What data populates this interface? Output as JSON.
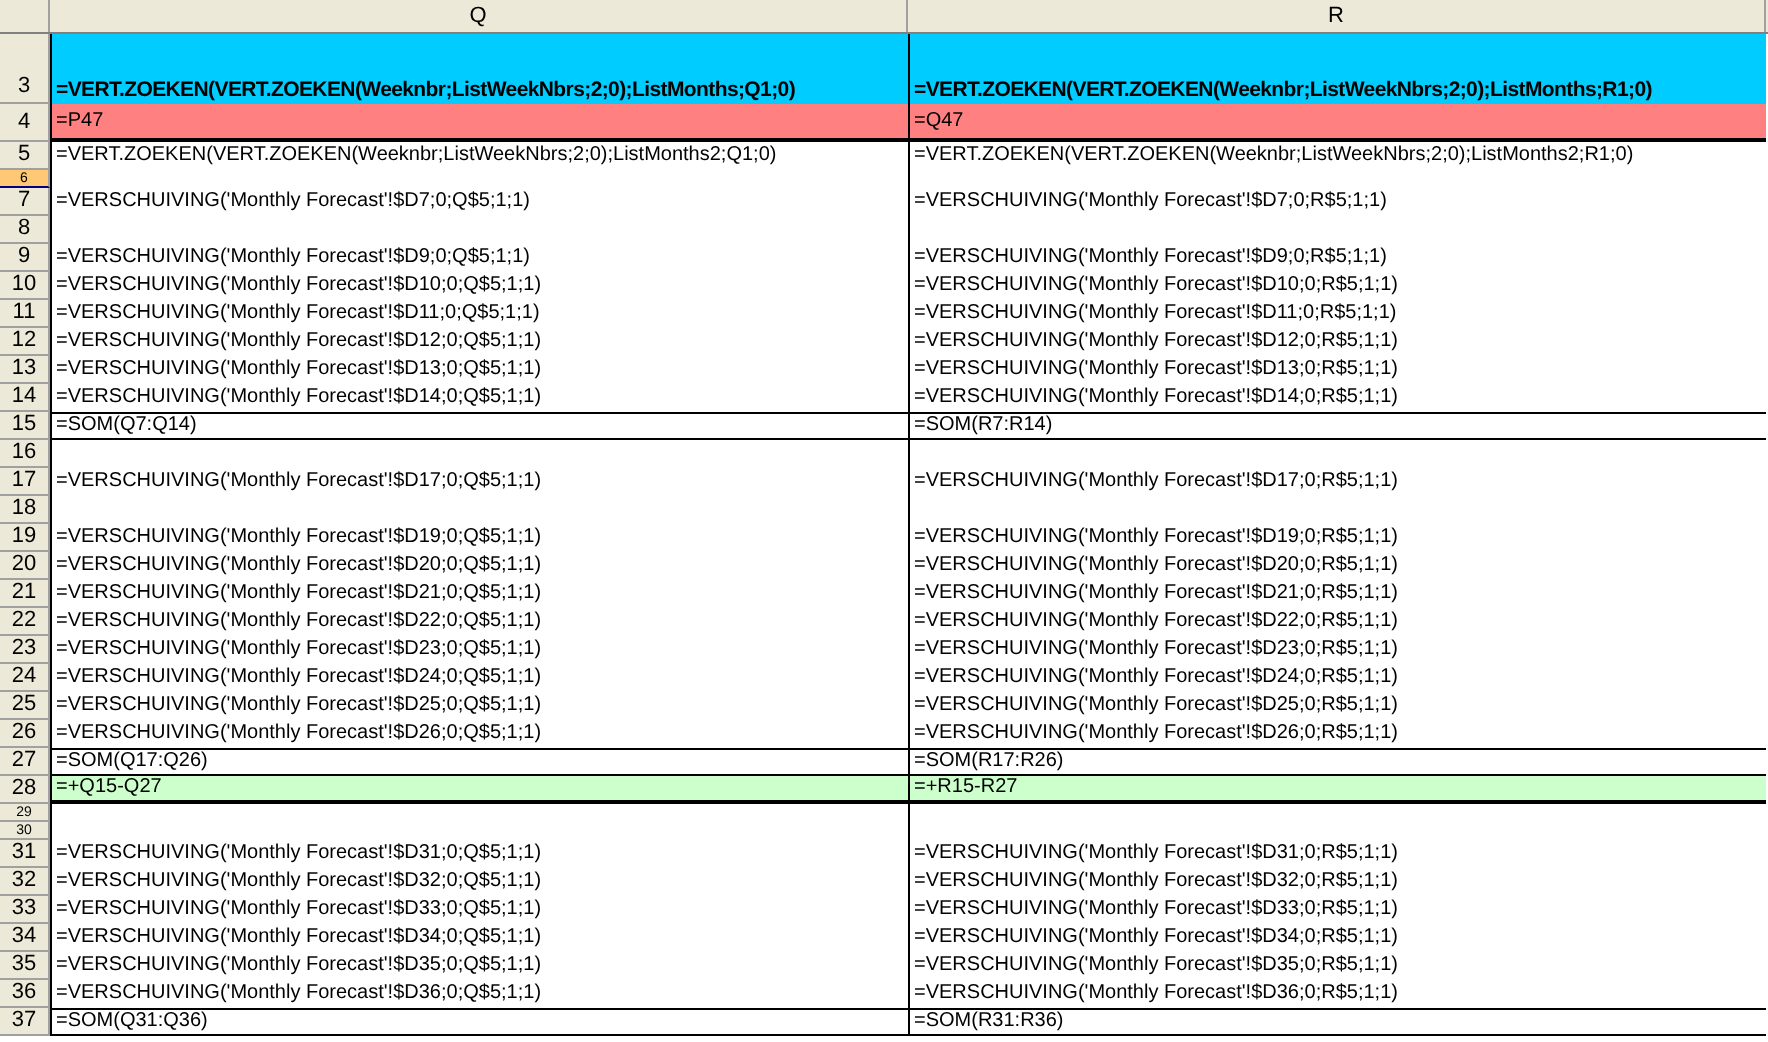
{
  "columns": [
    {
      "label": "Q"
    },
    {
      "label": "R"
    }
  ],
  "rows": [
    {
      "number": "3",
      "kind": "title",
      "selected": false,
      "cells": [
        "=VERT.ZOEKEN(VERT.ZOEKEN(Weeknbr;ListWeekNbrs;2;0);ListMonths;Q1;0)",
        "=VERT.ZOEKEN(VERT.ZOEKEN(Weeknbr;ListWeekNbrs;2;0);ListMonths;R1;0)"
      ]
    },
    {
      "number": "4",
      "kind": "pink",
      "selected": false,
      "cells": [
        "=P47",
        "=Q47"
      ]
    },
    {
      "number": "5",
      "kind": "plain",
      "selected": false,
      "cells": [
        "=VERT.ZOEKEN(VERT.ZOEKEN(Weeknbr;ListWeekNbrs;2;0);ListMonths2;Q1;0)",
        "=VERT.ZOEKEN(VERT.ZOEKEN(Weeknbr;ListWeekNbrs;2;0);ListMonths2;R1;0)"
      ]
    },
    {
      "number": "6",
      "kind": "short",
      "selected": true
    },
    {
      "number": "7",
      "kind": "plain",
      "selected": false,
      "cells": [
        "=VERSCHUIVING('Monthly Forecast'!$D7;0;Q$5;1;1)",
        "=VERSCHUIVING('Monthly Forecast'!$D7;0;R$5;1;1)"
      ]
    },
    {
      "number": "8",
      "kind": "plain",
      "selected": false
    },
    {
      "number": "9",
      "kind": "plain",
      "selected": false,
      "cells": [
        "=VERSCHUIVING('Monthly Forecast'!$D9;0;Q$5;1;1)",
        "=VERSCHUIVING('Monthly Forecast'!$D9;0;R$5;1;1)"
      ]
    },
    {
      "number": "10",
      "kind": "plain",
      "selected": false,
      "cells": [
        "=VERSCHUIVING('Monthly Forecast'!$D10;0;Q$5;1;1)",
        "=VERSCHUIVING('Monthly Forecast'!$D10;0;R$5;1;1)"
      ]
    },
    {
      "number": "11",
      "kind": "plain",
      "selected": false,
      "cells": [
        "=VERSCHUIVING('Monthly Forecast'!$D11;0;Q$5;1;1)",
        "=VERSCHUIVING('Monthly Forecast'!$D11;0;R$5;1;1)"
      ]
    },
    {
      "number": "12",
      "kind": "plain",
      "selected": false,
      "cells": [
        "=VERSCHUIVING('Monthly Forecast'!$D12;0;Q$5;1;1)",
        "=VERSCHUIVING('Monthly Forecast'!$D12;0;R$5;1;1)"
      ]
    },
    {
      "number": "13",
      "kind": "plain",
      "selected": false,
      "cells": [
        "=VERSCHUIVING('Monthly Forecast'!$D13;0;Q$5;1;1)",
        "=VERSCHUIVING('Monthly Forecast'!$D13;0;R$5;1;1)"
      ]
    },
    {
      "number": "14",
      "kind": "plain",
      "selected": false,
      "cells": [
        "=VERSCHUIVING('Monthly Forecast'!$D14;0;Q$5;1;1)",
        "=VERSCHUIVING('Monthly Forecast'!$D14;0;R$5;1;1)"
      ]
    },
    {
      "number": "15",
      "kind": "total",
      "selected": false,
      "cells": [
        "=SOM(Q7:Q14)",
        "=SOM(R7:R14)"
      ]
    },
    {
      "number": "16",
      "kind": "plain",
      "selected": false
    },
    {
      "number": "17",
      "kind": "plain",
      "selected": false,
      "cells": [
        "=VERSCHUIVING('Monthly Forecast'!$D17;0;Q$5;1;1)",
        "=VERSCHUIVING('Monthly Forecast'!$D17;0;R$5;1;1)"
      ]
    },
    {
      "number": "18",
      "kind": "plain",
      "selected": false
    },
    {
      "number": "19",
      "kind": "plain",
      "selected": false,
      "cells": [
        "=VERSCHUIVING('Monthly Forecast'!$D19;0;Q$5;1;1)",
        "=VERSCHUIVING('Monthly Forecast'!$D19;0;R$5;1;1)"
      ]
    },
    {
      "number": "20",
      "kind": "plain",
      "selected": false,
      "cells": [
        "=VERSCHUIVING('Monthly Forecast'!$D20;0;Q$5;1;1)",
        "=VERSCHUIVING('Monthly Forecast'!$D20;0;R$5;1;1)"
      ]
    },
    {
      "number": "21",
      "kind": "plain",
      "selected": false,
      "cells": [
        "=VERSCHUIVING('Monthly Forecast'!$D21;0;Q$5;1;1)",
        "=VERSCHUIVING('Monthly Forecast'!$D21;0;R$5;1;1)"
      ]
    },
    {
      "number": "22",
      "kind": "plain",
      "selected": false,
      "cells": [
        "=VERSCHUIVING('Monthly Forecast'!$D22;0;Q$5;1;1)",
        "=VERSCHUIVING('Monthly Forecast'!$D22;0;R$5;1;1)"
      ]
    },
    {
      "number": "23",
      "kind": "plain",
      "selected": false,
      "cells": [
        "=VERSCHUIVING('Monthly Forecast'!$D23;0;Q$5;1;1)",
        "=VERSCHUIVING('Monthly Forecast'!$D23;0;R$5;1;1)"
      ]
    },
    {
      "number": "24",
      "kind": "plain",
      "selected": false,
      "cells": [
        "=VERSCHUIVING('Monthly Forecast'!$D24;0;Q$5;1;1)",
        "=VERSCHUIVING('Monthly Forecast'!$D24;0;R$5;1;1)"
      ]
    },
    {
      "number": "25",
      "kind": "plain",
      "selected": false,
      "cells": [
        "=VERSCHUIVING('Monthly Forecast'!$D25;0;Q$5;1;1)",
        "=VERSCHUIVING('Monthly Forecast'!$D25;0;R$5;1;1)"
      ]
    },
    {
      "number": "26",
      "kind": "plain",
      "selected": false,
      "cells": [
        "=VERSCHUIVING('Monthly Forecast'!$D26;0;Q$5;1;1)",
        "=VERSCHUIVING('Monthly Forecast'!$D26;0;R$5;1;1)"
      ]
    },
    {
      "number": "27",
      "kind": "total",
      "selected": false,
      "cells": [
        "=SOM(Q17:Q26)",
        "=SOM(R17:R26)"
      ]
    },
    {
      "number": "28",
      "kind": "green",
      "selected": false,
      "cells": [
        "=+Q15-Q27",
        "=+R15-R27"
      ]
    },
    {
      "number": "29",
      "kind": "short",
      "selected": false
    },
    {
      "number": "30",
      "kind": "short",
      "selected": false
    },
    {
      "number": "31",
      "kind": "plain",
      "selected": false,
      "cells": [
        "=VERSCHUIVING('Monthly Forecast'!$D31;0;Q$5;1;1)",
        "=VERSCHUIVING('Monthly Forecast'!$D31;0;R$5;1;1)"
      ]
    },
    {
      "number": "32",
      "kind": "plain",
      "selected": false,
      "cells": [
        "=VERSCHUIVING('Monthly Forecast'!$D32;0;Q$5;1;1)",
        "=VERSCHUIVING('Monthly Forecast'!$D32;0;R$5;1;1)"
      ]
    },
    {
      "number": "33",
      "kind": "plain",
      "selected": false,
      "cells": [
        "=VERSCHUIVING('Monthly Forecast'!$D33;0;Q$5;1;1)",
        "=VERSCHUIVING('Monthly Forecast'!$D33;0;R$5;1;1)"
      ]
    },
    {
      "number": "34",
      "kind": "plain",
      "selected": false,
      "cells": [
        "=VERSCHUIVING('Monthly Forecast'!$D34;0;Q$5;1;1)",
        "=VERSCHUIVING('Monthly Forecast'!$D34;0;R$5;1;1)"
      ]
    },
    {
      "number": "35",
      "kind": "plain",
      "selected": false,
      "cells": [
        "=VERSCHUIVING('Monthly Forecast'!$D35;0;Q$5;1;1)",
        "=VERSCHUIVING('Monthly Forecast'!$D35;0;R$5;1;1)"
      ]
    },
    {
      "number": "36",
      "kind": "plain",
      "selected": false,
      "cells": [
        "=VERSCHUIVING('Monthly Forecast'!$D36;0;Q$5;1;1)",
        "=VERSCHUIVING('Monthly Forecast'!$D36;0;R$5;1;1)"
      ]
    },
    {
      "number": "37",
      "kind": "total",
      "selected": false,
      "cells": [
        "=SOM(Q31:Q36)",
        "=SOM(R31:R36)"
      ]
    }
  ]
}
